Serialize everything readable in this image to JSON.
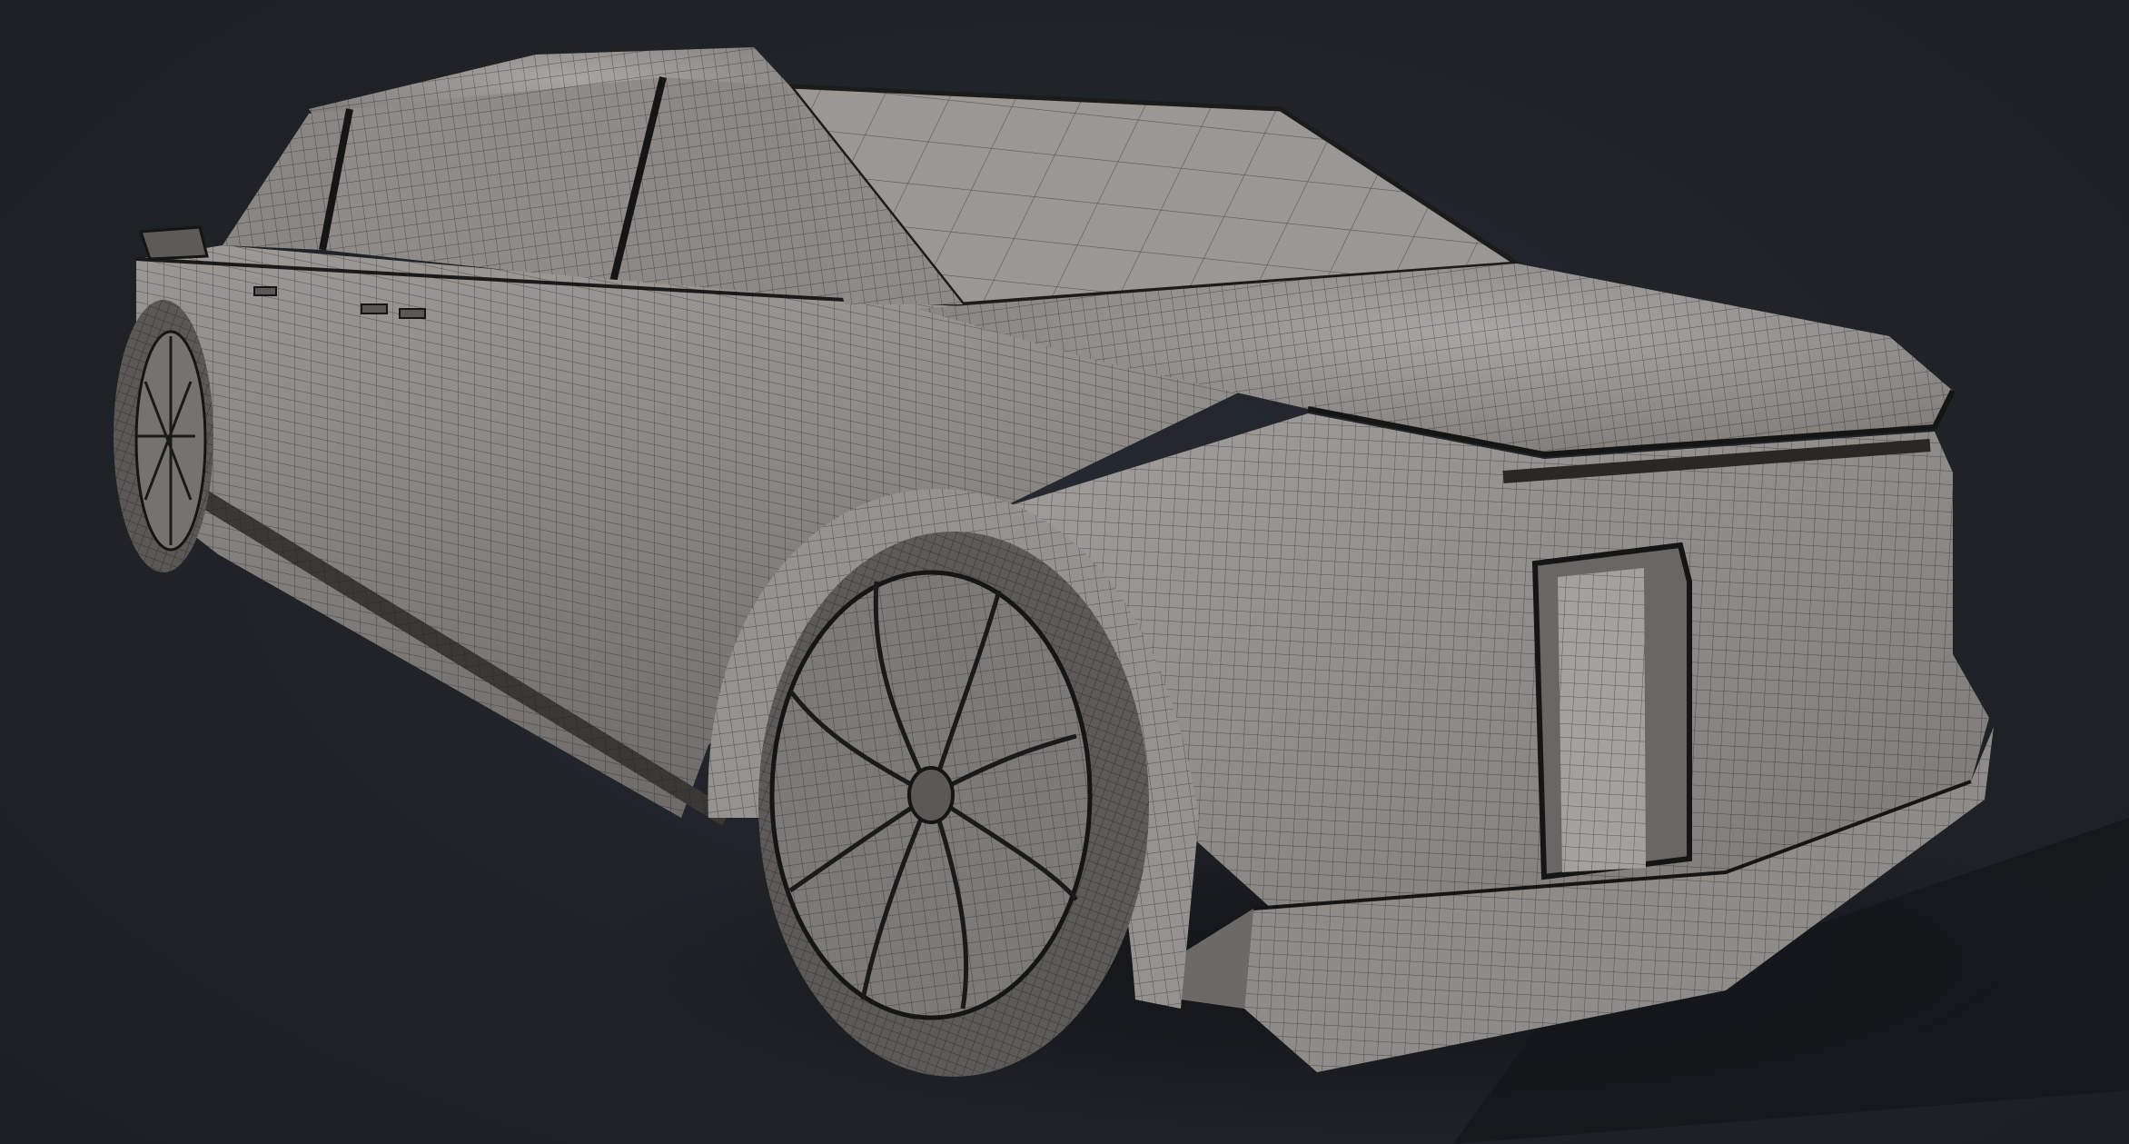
{
  "scene": {
    "subject": "car-wireframe-render",
    "colors": {
      "background": "#1f2227",
      "body_base": "#8d8987",
      "body_light": "#a9a5a2",
      "body_dark": "#625e5c",
      "glass": "#9b9794",
      "wire": "#1c1c1c",
      "shadow": "#121417"
    }
  }
}
